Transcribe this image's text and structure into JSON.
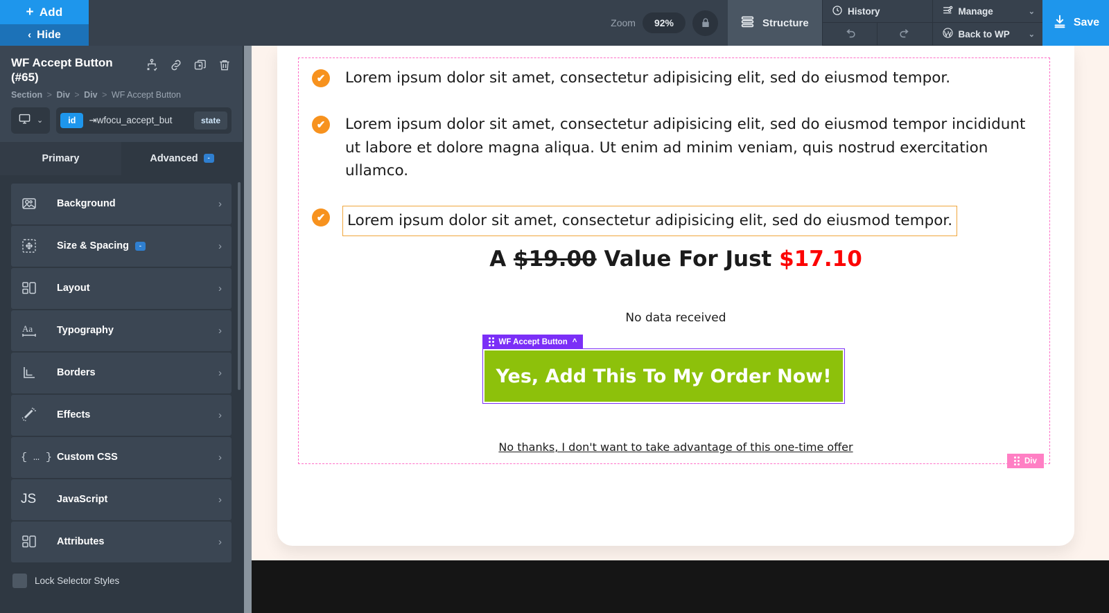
{
  "topbar": {
    "add_label": "Add",
    "add_plus": "+",
    "hide_label": "Hide",
    "hide_chevron": "‹",
    "zoom_label": "Zoom",
    "zoom_value": "92%",
    "lock_icon": "lock-icon",
    "structure_label": "Structure",
    "history_label": "History",
    "manage_label": "Manage",
    "back_to_wp_label": "Back to WP",
    "undo_icon": "undo-icon",
    "redo_icon": "redo-icon",
    "save_label": "Save",
    "caret": "⌄",
    "accent_blue": "#1e96ec",
    "bar_bg": "#37414d"
  },
  "sidebar": {
    "element_title": "WF Accept Button (#65)",
    "header_icons": [
      "conditions-icon",
      "link-icon",
      "duplicate-icon",
      "delete-icon"
    ],
    "breadcrumb": [
      "Section",
      "Div",
      "Div",
      "WF Accept Button"
    ],
    "breadcrumb_separator": ">",
    "device_icon": "desktop-icon",
    "device_caret": "⌄",
    "id_badge": "id",
    "selector_value": "⇥wfocu_accept_but",
    "state_badge": "state",
    "tabs": [
      {
        "label": "Primary",
        "active": false,
        "badge": ""
      },
      {
        "label": "Advanced",
        "active": true,
        "badge": "-"
      }
    ],
    "options": [
      {
        "label": "Background",
        "icon": "image-icon",
        "badge": ""
      },
      {
        "label": "Size & Spacing",
        "icon": "move-arrows-icon",
        "badge": "-"
      },
      {
        "label": "Layout",
        "icon": "layout-icon",
        "badge": ""
      },
      {
        "label": "Typography",
        "icon": "typography-icon",
        "badge": ""
      },
      {
        "label": "Borders",
        "icon": "borders-icon",
        "badge": ""
      },
      {
        "label": "Effects",
        "icon": "magic-wand-icon",
        "badge": ""
      },
      {
        "label": "Custom CSS",
        "icon": "braces-icon",
        "badge": ""
      },
      {
        "label": "JavaScript",
        "icon": "js-icon",
        "badge": ""
      },
      {
        "label": "Attributes",
        "icon": "attributes-icon",
        "badge": ""
      }
    ],
    "chevron": "›",
    "lock_selector_label": "Lock Selector Styles"
  },
  "canvas": {
    "bullets": [
      "Lorem ipsum dolor sit amet, consectetur adipisicing elit, sed do eiusmod tempor.",
      "Lorem ipsum dolor sit amet, consectetur adipisicing elit, sed do eiusmod tempor incididunt ut labore et dolore magna aliqua. Ut enim ad minim veniam, quis nostrud exercitation ullamco.",
      "Lorem ipsum dolor sit amet, consectetur adipisicing elit, sed do eiusmod tempor."
    ],
    "check_glyph": "✔",
    "price_prefix": "A",
    "price_old": "$19.00",
    "price_middle": "Value For Just",
    "price_new": "$17.10",
    "no_data_text": "No data received",
    "element_badge_label": "WF Accept Button",
    "element_badge_caret": "^",
    "cta_label": "Yes, Add This To My Order Now!",
    "decline_label": "No thanks, I don't want to take advantage of this one-time offer",
    "div_badge_label": "Div",
    "colors": {
      "cta_green": "#8dc10b",
      "price_red": "#fc0303",
      "check_orange": "#f7921e",
      "selection_purple": "#7b2ff7",
      "div_pink": "#ff7fc4",
      "section_dashed": "#ff6ec7",
      "highlight_orange": "#f0a63c"
    }
  }
}
